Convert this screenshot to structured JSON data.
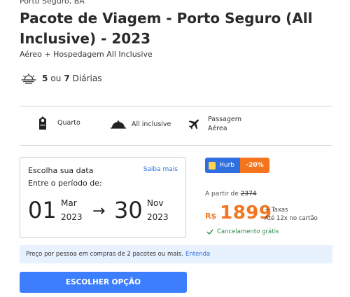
{
  "header": {
    "location": "Porto Seguro, BA",
    "title": "Pacote de Viagem - Porto Seguro (All Inclusive) - 2023",
    "subtitle": "Aéreo + Hospedagem All Inclusive"
  },
  "duration": {
    "min": "5",
    "separator": "ou",
    "max": "7",
    "unit": "Diárias",
    "icon": "sunset-icon"
  },
  "amenities": [
    {
      "icon": "door-hanger-icon",
      "label": "Quarto"
    },
    {
      "icon": "cloche-icon",
      "label": "All inclusive"
    },
    {
      "icon": "airplane-icon",
      "label_line1": "Passagem",
      "label_line2": "Aérea"
    }
  ],
  "date_selector": {
    "heading": "Escolha sua data",
    "help_link": "Saiba mais",
    "period_label": "Entre o período de:",
    "start": {
      "day": "01",
      "month": "Mar",
      "year": "2023"
    },
    "arrow": "→",
    "end": {
      "day": "30",
      "month": "Nov",
      "year": "2023"
    }
  },
  "pricing": {
    "brand": "Hurb",
    "discount": "-20%",
    "from_label": "A partir de",
    "old_price": "2374",
    "currency": "R$",
    "price": "1899",
    "taxes": "+ Taxas",
    "installments": "Até 12x no cartão",
    "cancellation": "Cancelamento grátis",
    "colors": {
      "accent": "#f5751f",
      "brand": "#2f6fe0",
      "success": "#2f8a4a"
    }
  },
  "info_bar": {
    "text": "Preço por pessoa em compras de 2 pacotes ou mais.",
    "link": "Entenda"
  },
  "cta": {
    "label": "ESCOLHER OPÇÃO",
    "color": "#3d7eff"
  }
}
